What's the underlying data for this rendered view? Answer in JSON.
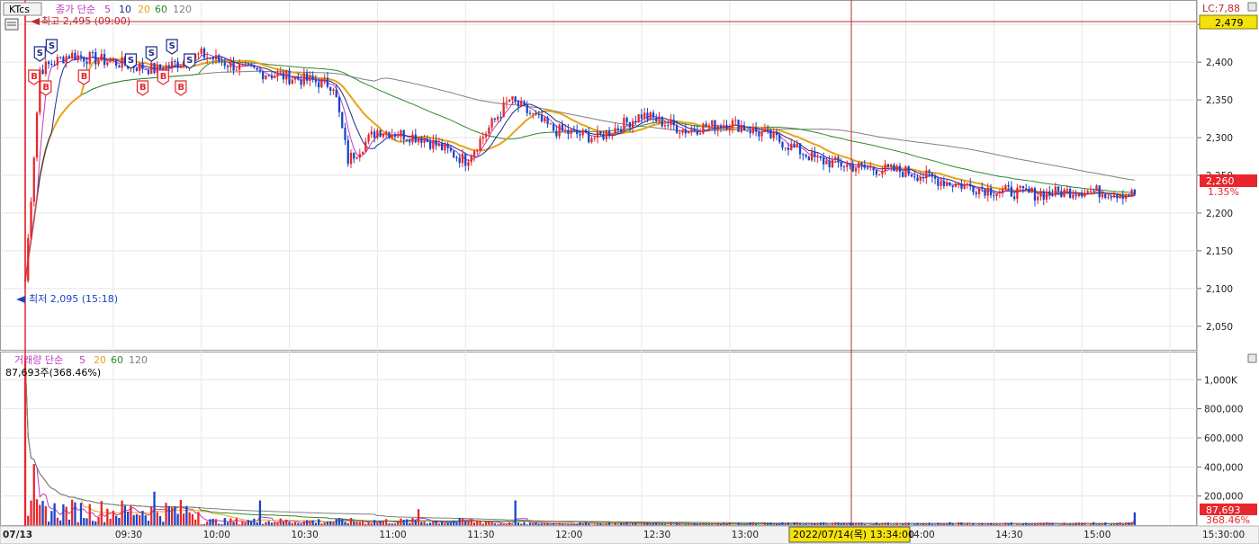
{
  "header": {
    "symbol": "KTcs",
    "price_ma_title": "종가 단순",
    "ma_periods": [
      "5",
      "10",
      "20",
      "60",
      "120"
    ],
    "lc_label": "LC:7,88",
    "high_marker": "최고 2,495 (09:00)",
    "low_marker": "최저 2,095 (15:18)"
  },
  "volume_header": {
    "title": "거래량 단순",
    "ma_periods": [
      "5",
      "20",
      "60",
      "120"
    ],
    "current_volume": "87,693주(368.46%)"
  },
  "right_axis": {
    "current_price_box": "2,479",
    "last_price_box": "2,260",
    "change_pct": "1.35%",
    "volume_box": "87,693",
    "volume_pct_box": "368.46%"
  },
  "crosshair": {
    "label": "2022/07/14(목) 13:34:00"
  },
  "x_axis": {
    "labels": [
      "07/13",
      "09:30",
      "10:00",
      "10:30",
      "11:00",
      "11:30",
      "12:00",
      "12:30",
      "13:00",
      "14:00",
      "14:30",
      "15:00",
      "15:30:00"
    ]
  },
  "colors": {
    "up": "#e8262b",
    "down": "#1a45c8",
    "ma5": "#c23ac0",
    "ma10": "#1e2d8a",
    "ma20": "#e8a317",
    "ma60": "#2d8a2d",
    "ma120": "#808080",
    "crosshair": "#c0282d"
  },
  "chart_data": {
    "type": "candlestick",
    "price_axis": {
      "ticks": [
        2050,
        2100,
        2150,
        2200,
        2250,
        2300,
        2350,
        2400,
        2450
      ],
      "range": [
        2020,
        2480
      ]
    },
    "volume_axis": {
      "ticks": [
        "200,000",
        "400,000",
        "600,000",
        "800,000",
        "1,000K"
      ],
      "range": [
        0,
        1150000
      ]
    },
    "high": 2495,
    "low": 2095,
    "last_price": 2260,
    "last_volume": 87693,
    "key_points": [
      {
        "t": "09:00",
        "p": 2110
      },
      {
        "t": "09:05",
        "p": 2390
      },
      {
        "t": "09:15",
        "p": 2410
      },
      {
        "t": "09:30",
        "p": 2400
      },
      {
        "t": "09:45",
        "p": 2390
      },
      {
        "t": "10:00",
        "p": 2410
      },
      {
        "t": "10:15",
        "p": 2390
      },
      {
        "t": "10:30",
        "p": 2380
      },
      {
        "t": "10:45",
        "p": 2370
      },
      {
        "t": "10:50",
        "p": 2270
      },
      {
        "t": "11:00",
        "p": 2310
      },
      {
        "t": "11:15",
        "p": 2300
      },
      {
        "t": "11:30",
        "p": 2270
      },
      {
        "t": "11:45",
        "p": 2350
      },
      {
        "t": "12:00",
        "p": 2310
      },
      {
        "t": "12:15",
        "p": 2300
      },
      {
        "t": "12:30",
        "p": 2330
      },
      {
        "t": "12:45",
        "p": 2310
      },
      {
        "t": "13:00",
        "p": 2320
      },
      {
        "t": "13:15",
        "p": 2300
      },
      {
        "t": "13:30",
        "p": 2270
      },
      {
        "t": "13:45",
        "p": 2260
      },
      {
        "t": "14:00",
        "p": 2255
      },
      {
        "t": "14:15",
        "p": 2240
      },
      {
        "t": "14:30",
        "p": 2230
      },
      {
        "t": "14:45",
        "p": 2225
      },
      {
        "t": "15:00",
        "p": 2230
      },
      {
        "t": "15:18",
        "p": 2225
      }
    ],
    "signals": [
      {
        "t": "09:03",
        "type": "B"
      },
      {
        "t": "09:05",
        "type": "S"
      },
      {
        "t": "09:07",
        "type": "B"
      },
      {
        "t": "09:09",
        "type": "S"
      },
      {
        "t": "09:20",
        "type": "B"
      },
      {
        "t": "09:36",
        "type": "S"
      },
      {
        "t": "09:40",
        "type": "B"
      },
      {
        "t": "09:43",
        "type": "S"
      },
      {
        "t": "09:47",
        "type": "B"
      },
      {
        "t": "09:50",
        "type": "S"
      },
      {
        "t": "09:53",
        "type": "B"
      },
      {
        "t": "09:56",
        "type": "S"
      }
    ]
  }
}
